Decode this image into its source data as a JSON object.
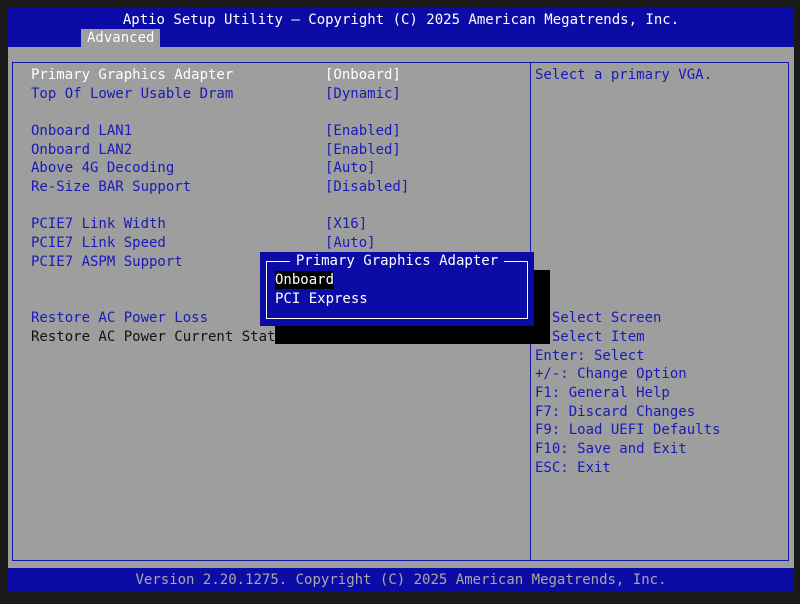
{
  "header": {
    "title": "Aptio Setup Utility – Copyright (C) 2025 American Megatrends, Inc.",
    "tab": "Advanced"
  },
  "settings": [
    {
      "label": "Primary Graphics Adapter",
      "value": "[Onboard]"
    },
    {
      "label": "Top Of Lower Usable Dram",
      "value": "[Dynamic]"
    },
    {
      "label": "Onboard LAN1",
      "value": "[Enabled]"
    },
    {
      "label": "Onboard LAN2",
      "value": "[Enabled]"
    },
    {
      "label": "Above 4G Decoding",
      "value": "[Auto]"
    },
    {
      "label": "Re-Size BAR Support",
      "value": "[Disabled]"
    },
    {
      "label": "PCIE7 Link Width",
      "value": "[X16]"
    },
    {
      "label": "PCIE7 Link Speed",
      "value": "[Auto]"
    },
    {
      "label": "PCIE7 ASPM Support",
      "value": ""
    },
    {
      "label": "Restore AC Power Loss",
      "value": ""
    },
    {
      "label": "Restore AC Power Current State",
      "value": ""
    }
  ],
  "help": {
    "description": "Select a primary VGA.",
    "keys": [
      ": Select Screen",
      ": Select Item",
      "Enter: Select",
      "+/-: Change Option",
      "F1: General Help",
      "F7: Discard Changes",
      "F9: Load UEFI Defaults",
      "F10: Save and Exit",
      "ESC: Exit"
    ]
  },
  "popup": {
    "title": "Primary Graphics Adapter",
    "options": [
      "Onboard",
      "PCI Express"
    ],
    "selected_index": 0
  },
  "footer": {
    "text": "Version 2.20.1275. Copyright (C) 2025 American Megatrends, Inc."
  },
  "colors": {
    "background": "#9e9e9e",
    "header_blue": "#0b0ca6",
    "item_text": "#1a1ab8",
    "highlight_text": "#ffffff"
  }
}
